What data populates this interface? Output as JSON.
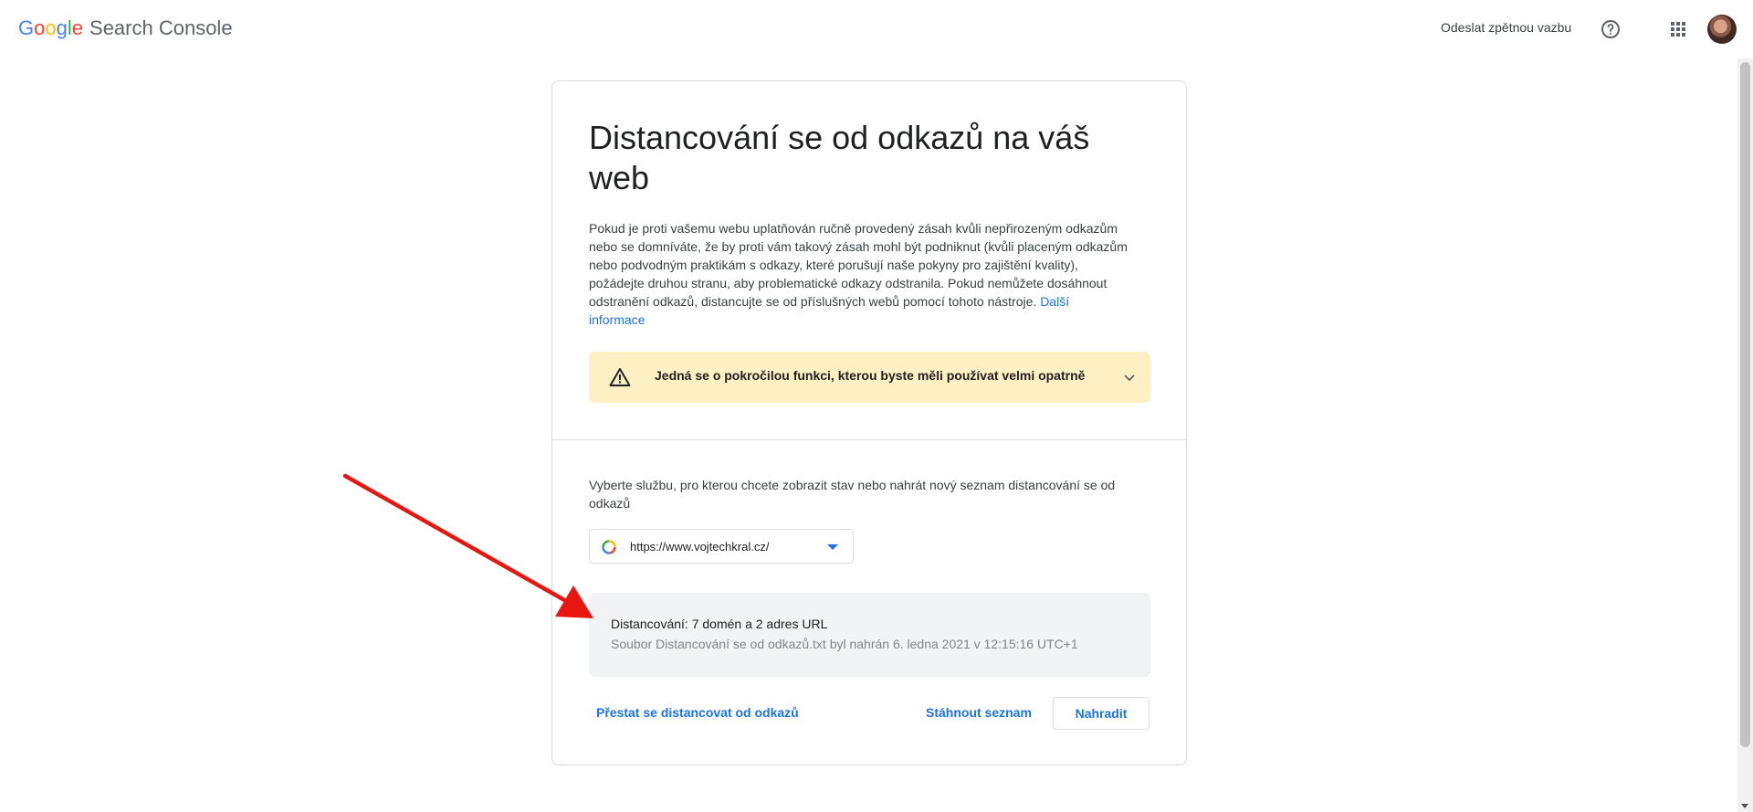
{
  "header": {
    "logo_letters": [
      "G",
      "o",
      "o",
      "g",
      "l",
      "e"
    ],
    "product_name": "Search Console",
    "feedback_label": "Odeslat zpětnou vazbu",
    "help_icon": "help-circle-icon",
    "apps_icon": "apps-grid-icon"
  },
  "card": {
    "title": "Distancování se od odkazů na váš web",
    "description": "Pokud je proti vašemu webu uplatňován ručně provedený zásah kvůli nepřirozeným odkazům nebo se domníváte, že by proti vám takový zásah mohl být podniknut (kvůli placeným odkazům nebo podvodným praktikám s odkazy, které porušují naše pokyny pro zajištění kvality), požádejte druhou stranu, aby problematické odkazy odstranila. Pokud nemůžete dosáhnout odstranění odkazů, distancujte se od příslušných webů pomocí tohoto nástroje.",
    "more_info_link": "Další informace",
    "warning_text": "Jedná se o pokročilou funkci, kterou byste měli používat velmi opatrně",
    "select_label": "Vyberte službu, pro kterou chcete zobrazit stav nebo nahrát nový seznam distancování se od odkazů",
    "selected_property": "https://www.vojtechkral.cz/",
    "status_title": "Distancování: 7 domén a 2 adres URL",
    "status_subtitle": "Soubor Distancování se od odkazů.txt byl nahrán 6. ledna 2021 v 12:15:16 UTC+1",
    "btn_stop": "Přestat se distancovat od odkazů",
    "btn_download": "Stáhnout seznam",
    "btn_replace": "Nahradit"
  },
  "colors": {
    "accent": "#1a73e8",
    "warning_bg": "#fef0c3",
    "status_bg": "#f1f3f4",
    "annotation_arrow": "#e8160f"
  }
}
